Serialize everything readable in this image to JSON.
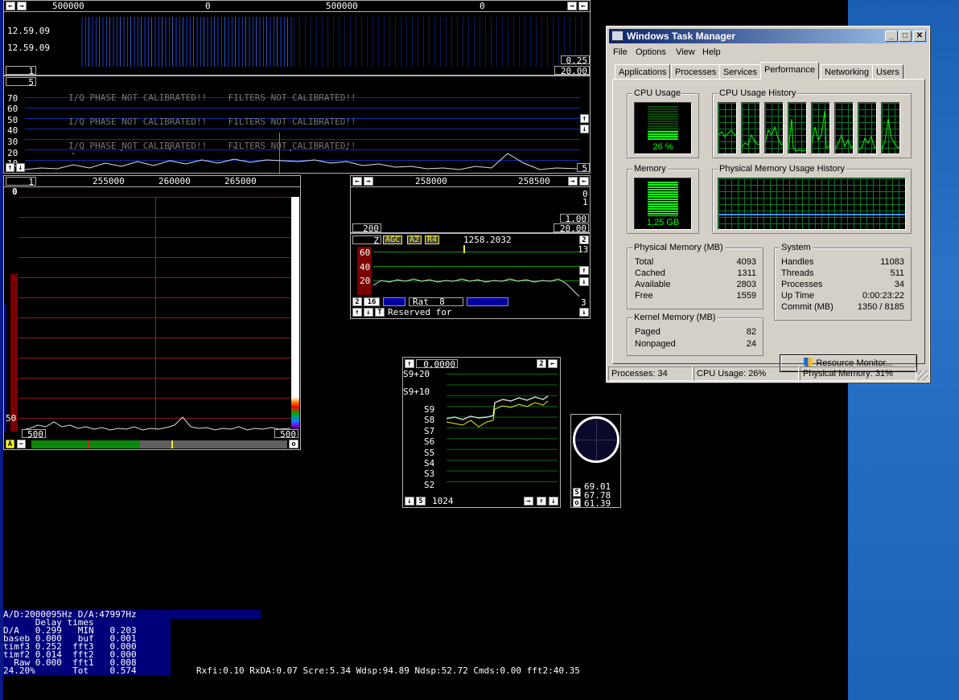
{
  "waterfall": {
    "freq_ticks": [
      "500000",
      "0",
      "500000",
      "0"
    ],
    "times": [
      "12.59.09",
      "12.59.09"
    ],
    "left_box": "1",
    "right_box_1": "0.25",
    "right_box_2": "20.00"
  },
  "spectrum_wide": {
    "left_box": "5",
    "warning": "I/Q PHASE NOT CALIBRATED!!    FILTERS NOT CALIBRATED!!",
    "y_ticks": [
      "70",
      "60",
      "50",
      "40",
      "30",
      "20",
      "10"
    ],
    "right_box": "5"
  },
  "baseband": {
    "left_box": "1",
    "freq_ticks": [
      "255000",
      "260000",
      "265000"
    ],
    "top_label": "0",
    "y_label": "50",
    "box_left": "500",
    "box_right": "500",
    "mode_a": "A",
    "mode_o": "o"
  },
  "hires": {
    "freq_ticks": [
      "258000",
      "258500"
    ],
    "right_vals": [
      "0",
      "1"
    ],
    "box_200": "200",
    "box_100": "1.00",
    "box_2000": "20.00"
  },
  "afc": {
    "z_btn": "Z",
    "agc": "AGC",
    "a2": "A2",
    "r4": "R4",
    "freq": "1258.2032",
    "n2": "2",
    "n13": "13",
    "y_ticks": [
      "60",
      "40",
      "20"
    ],
    "n3": "3",
    "box_2": "2",
    "box_16": "16",
    "rat": "Rat  8",
    "reserved": "Reserved for",
    "t": "T"
  },
  "smeter": {
    "value": "0.0000",
    "n2": "2",
    "levels": [
      "S9+20",
      "S9+10",
      "S9",
      "S8",
      "S7",
      "S6",
      "S5",
      "S4",
      "S3",
      "S2"
    ],
    "s_btn": "S",
    "count": "1024"
  },
  "scope": {
    "s": "S",
    "o": "o",
    "v1": "69.01",
    "v2": "67.78",
    "v3": "61.39"
  },
  "status": {
    "rates": "A/D:2000095Hz D/A:47997Hz",
    "delay_title": "      Delay times",
    "delay_rows": [
      "D/A   0.299   MIN   0.203",
      "baseb 0.000   buf   0.001",
      "timf3 0.252  fft3   0.000",
      "timf2 0.014  fft2   0.000",
      "  Raw 0.000  fft1   0.008",
      "24.20%       Tot    0.574"
    ],
    "perf": "Rxfi:0.10  RxDA:0.07  Scre:5.34  Wdsp:94.89  Ndsp:52.72  Cmds:0.00  fft2:40.35"
  },
  "taskmgr": {
    "title": "Windows Task Manager",
    "menu": [
      "File",
      "Options",
      "View",
      "Help"
    ],
    "tabs": [
      "Applications",
      "Processes",
      "Services",
      "Performance",
      "Networking",
      "Users"
    ],
    "cpu_usage_label": "CPU Usage",
    "cpu_value": "26 %",
    "cpu_history_label": "CPU Usage History",
    "memory_label": "Memory",
    "memory_value": "1,25 GB",
    "mem_history_label": "Physical Memory Usage History",
    "phys_label": "Physical Memory (MB)",
    "phys": [
      {
        "k": "Total",
        "v": "4093"
      },
      {
        "k": "Cached",
        "v": "1311"
      },
      {
        "k": "Available",
        "v": "2803"
      },
      {
        "k": "Free",
        "v": "1559"
      }
    ],
    "kernel_label": "Kernel Memory (MB)",
    "kernel": [
      {
        "k": "Paged",
        "v": "82"
      },
      {
        "k": "Nonpaged",
        "v": "24"
      }
    ],
    "system_label": "System",
    "system": [
      {
        "k": "Handles",
        "v": "11083"
      },
      {
        "k": "Threads",
        "v": "511"
      },
      {
        "k": "Processes",
        "v": "34"
      },
      {
        "k": "Up Time",
        "v": "0:00:23:22"
      },
      {
        "k": "Commit (MB)",
        "v": "1350 / 8185"
      }
    ],
    "resource_btn": "Resource Monitor...",
    "status_processes": "Processes: 34",
    "status_cpu": "CPU Usage: 26%",
    "status_mem": "Physical Memory: 31%",
    "cpu_percent": 26,
    "mem_percent": 31
  }
}
